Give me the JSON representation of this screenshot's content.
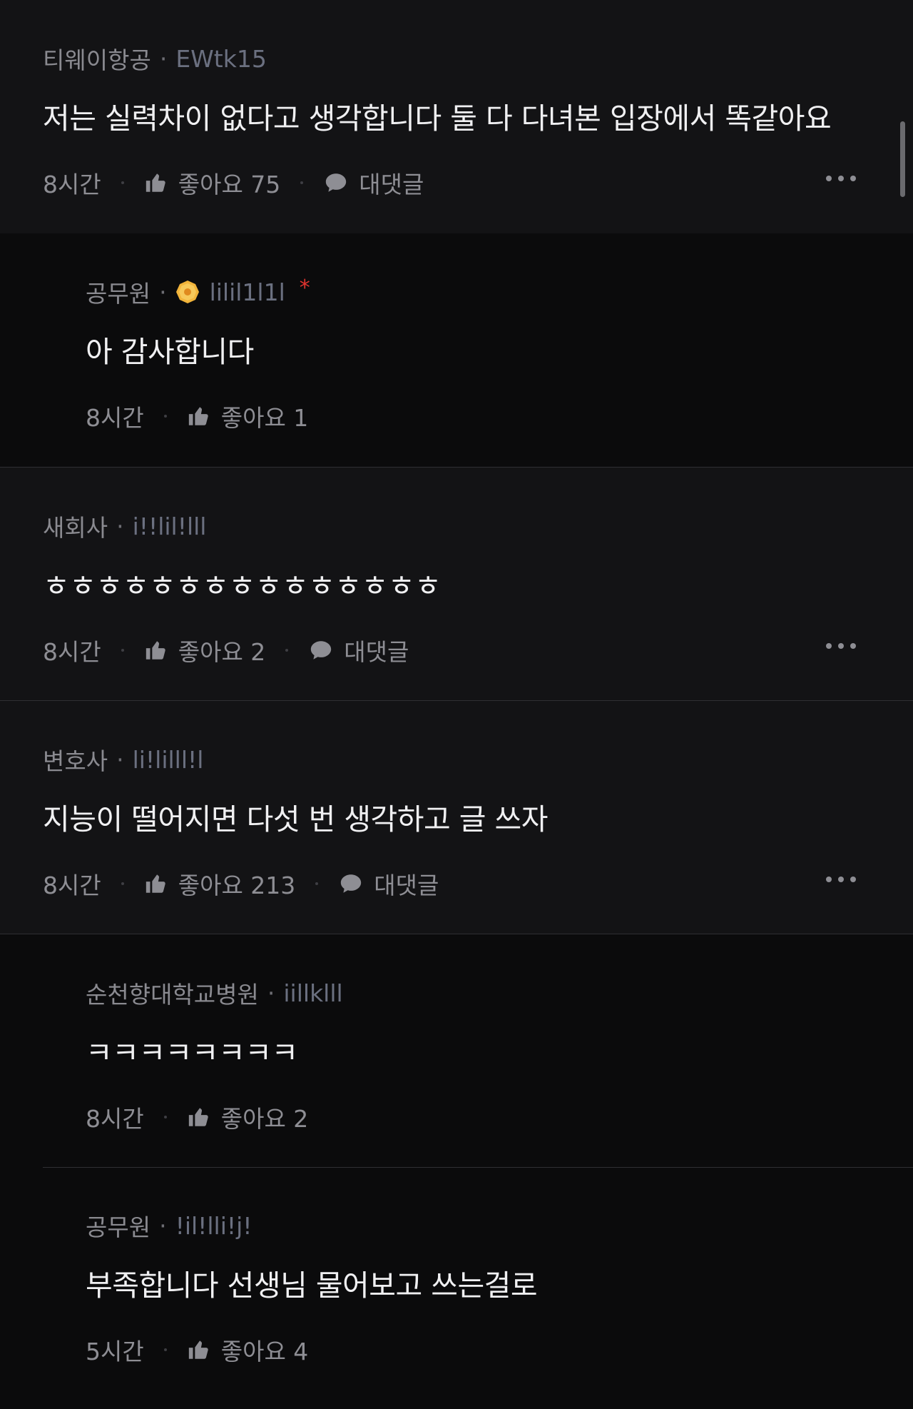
{
  "comments": [
    {
      "company": "티웨이항공",
      "nickname": "EWtk15",
      "text": "저는 실력차이 없다고 생각합니다 둘 다 다녀본 입장에서 똑같아요",
      "time": "8시간",
      "like_label": "좋아요 75",
      "reply_label": "대댓글"
    },
    {
      "company": "공무원",
      "nickname": "lilil1l1l",
      "author_badge": "*",
      "text": "아 감사합니다",
      "time": "8시간",
      "like_label": "좋아요 1"
    },
    {
      "company": "새회사",
      "nickname": "i!!lil!lll",
      "text": "ㅎㅎㅎㅎㅎㅎㅎㅎㅎㅎㅎㅎㅎㅎㅎ",
      "time": "8시간",
      "like_label": "좋아요 2",
      "reply_label": "대댓글"
    },
    {
      "company": "변호사",
      "nickname": "li!lilll!l",
      "text": "지능이 떨어지면 다섯 번 생각하고 글 쓰자",
      "time": "8시간",
      "like_label": "좋아요 213",
      "reply_label": "대댓글"
    },
    {
      "company": "순천향대학교병원",
      "nickname": "iillklll",
      "text": "ㅋㅋㅋㅋㅋㅋㅋㅋ",
      "time": "8시간",
      "like_label": "좋아요 2"
    },
    {
      "company": "공무원",
      "nickname": "!il!lli!j!",
      "text": "부족합니다 선생님 물어보고 쓰는걸로",
      "time": "5시간",
      "like_label": "좋아요 4"
    }
  ],
  "meta_separator": "·",
  "icons": {
    "like": "thumbs-up-icon",
    "reply": "speech-bubble-icon",
    "more": "more-dots-icon",
    "badge": "gold-badge-icon"
  },
  "colors": {
    "background": "#131315",
    "reply_background": "#0b0b0c",
    "nickname": "#6b7080",
    "author_badge": "#e0332f",
    "badge": "#f2b43a"
  }
}
